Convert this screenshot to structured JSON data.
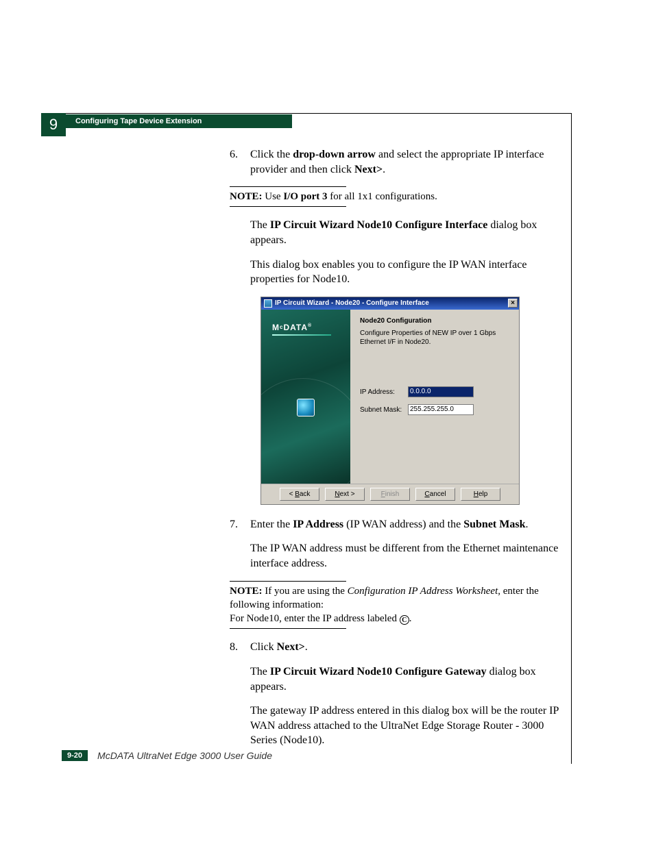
{
  "header": {
    "chapter_num": "9",
    "section_title": "Configuring Tape Device Extension"
  },
  "steps": {
    "s6": {
      "num": "6.",
      "pre": "Click the ",
      "bold1": "drop-down arrow",
      "mid": " and select the appropriate IP interface provider and then click ",
      "bold2": "Next>",
      "post": "."
    },
    "note1": {
      "label": "NOTE:",
      "pre": " Use ",
      "bold": "I/O port 3",
      "post": " for all 1x1 configurations."
    },
    "para1a": "The ",
    "para1b": "IP Circuit Wizard Node10 Configure Interface",
    "para1c": " dialog box appears.",
    "para2": "This dialog box enables you to configure the IP WAN interface properties for Node10.",
    "s7": {
      "num": "7.",
      "pre": "Enter the ",
      "b1": "IP Address",
      "mid": " (IP WAN address) and the ",
      "b2": "Subnet Mask",
      "post": "."
    },
    "para3": "The IP WAN address must be different from the Ethernet maintenance interface address.",
    "note2": {
      "label": "NOTE:",
      "pre": " If you are using the ",
      "ital": "Configuration IP Address Worksheet",
      "mid": ", enter the following information:",
      "line2a": "For Node10, enter the IP address labeled ",
      "circled": "C",
      "line2b": "."
    },
    "s8": {
      "num": "8.",
      "pre": "Click ",
      "b1": "Next>",
      "post": "."
    },
    "para4a": "The ",
    "para4b": "IP Circuit Wizard Node10 Configure Gateway",
    "para4c": " dialog box appears.",
    "para5": "The gateway IP address entered in this dialog box will be the router IP WAN address attached to the UltraNet Edge Storage Router - 3000 Series (Node10)."
  },
  "dialog": {
    "title": "IP Circuit Wizard - Node20 - Configure Interface",
    "brand": "M DATA",
    "brand_c": "c",
    "heading": "Node20 Configuration",
    "desc": "Configure Properties of NEW IP over 1 Gbps Ethernet I/F in Node20.",
    "ip_label": "IP Address:",
    "ip_value": "0.0.0.0",
    "mask_label": "Subnet Mask:",
    "mask_value": "255.255.255.0",
    "btn_back": "< Back",
    "btn_back_u": "B",
    "btn_next": "Next >",
    "btn_next_u": "N",
    "btn_finish": "Finish",
    "btn_finish_u": "F",
    "btn_cancel": "Cancel",
    "btn_cancel_u": "C",
    "btn_help": "Help",
    "btn_help_u": "H",
    "close": "×"
  },
  "footer": {
    "page_num": "9-20",
    "guide": "McDATA UltraNet Edge 3000 User Guide"
  }
}
